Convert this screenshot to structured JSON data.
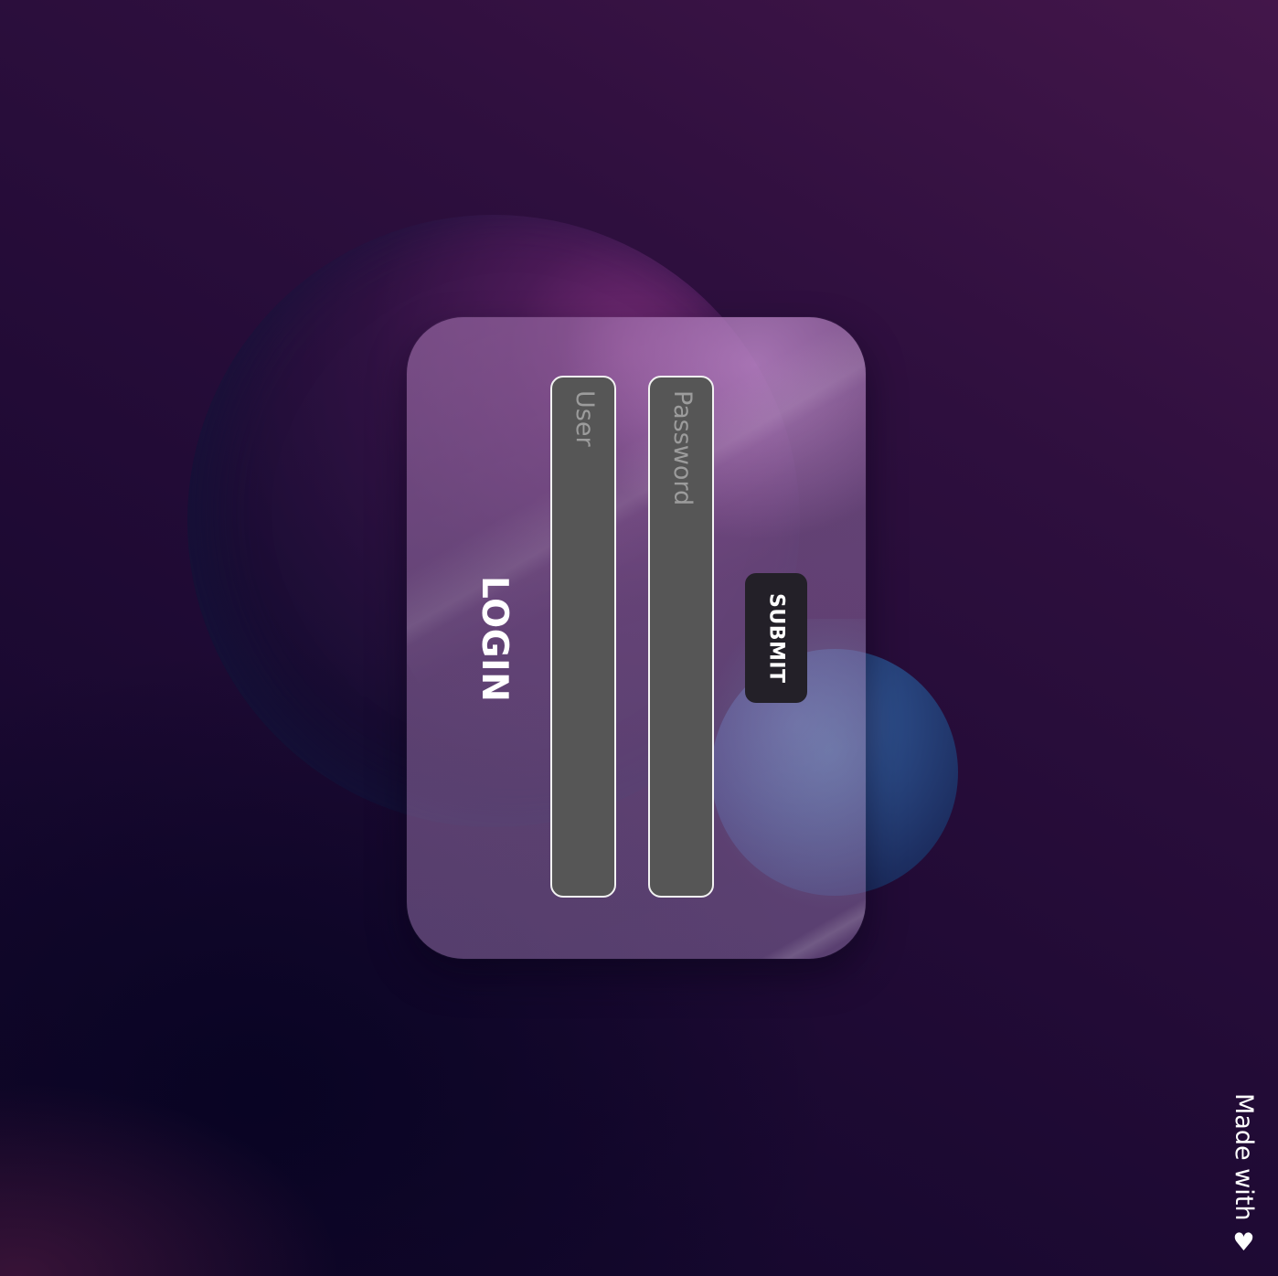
{
  "form": {
    "title": "LOGIN",
    "user_placeholder": "User",
    "password_placeholder": "Password",
    "submit_label": "SUBMIT"
  },
  "footer": {
    "text": "Made with ♥"
  },
  "colors": {
    "background_top": "#43164a",
    "background_bottom": "#120626",
    "orb_pink": "#782d78",
    "orb_blue": "#2b4a85",
    "field_fill": "#565656",
    "button_fill": "#232028"
  }
}
